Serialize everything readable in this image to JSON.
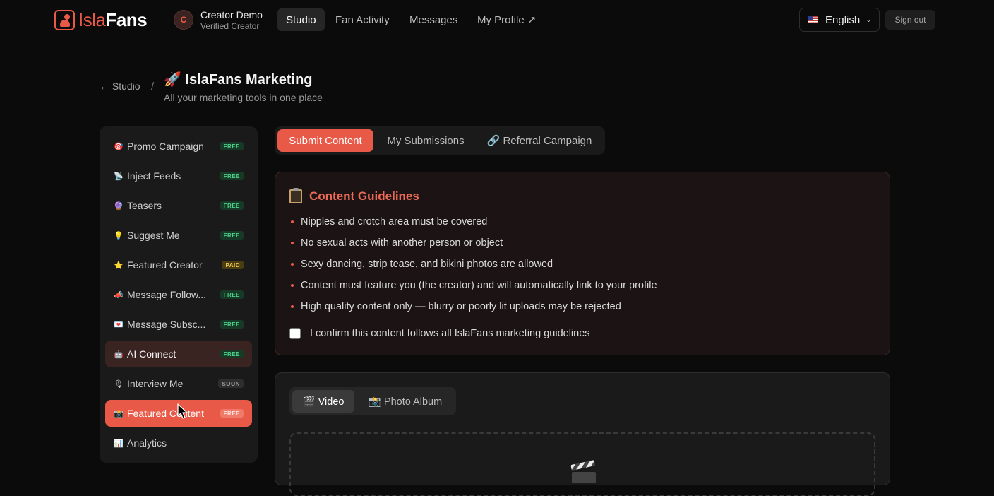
{
  "header": {
    "logo_isla": "Isla",
    "logo_fans": "Fans",
    "avatar_initial": "C",
    "creator_name": "Creator Demo",
    "creator_status": "Verified Creator",
    "nav": [
      {
        "label": "Studio",
        "active": true
      },
      {
        "label": "Fan Activity",
        "active": false
      },
      {
        "label": "Messages",
        "active": false
      },
      {
        "label": "My Profile ↗",
        "active": false
      }
    ],
    "language": "English",
    "sign_out": "Sign out"
  },
  "page": {
    "back_label": "← Studio",
    "separator": "/",
    "title": "🚀 IslaFans Marketing",
    "subtitle": "All your marketing tools in one place"
  },
  "sidebar": {
    "items": [
      {
        "icon": "🎯",
        "label": "Promo Campaign",
        "badge": "FREE",
        "state": "normal"
      },
      {
        "icon": "📡",
        "label": "Inject Feeds",
        "badge": "FREE",
        "state": "normal"
      },
      {
        "icon": "🔮",
        "label": "Teasers",
        "badge": "FREE",
        "state": "normal"
      },
      {
        "icon": "💡",
        "label": "Suggest Me",
        "badge": "FREE",
        "state": "normal"
      },
      {
        "icon": "⭐",
        "label": "Featured Creator",
        "badge": "PAID",
        "state": "normal"
      },
      {
        "icon": "📣",
        "label": "Message Follow...",
        "badge": "FREE",
        "state": "normal"
      },
      {
        "icon": "💌",
        "label": "Message Subsc...",
        "badge": "FREE",
        "state": "normal"
      },
      {
        "icon": "🤖",
        "label": "AI Connect",
        "badge": "FREE",
        "state": "hover"
      },
      {
        "icon": "🎙",
        "label": "Interview Me",
        "badge": "SOON",
        "state": "normal"
      },
      {
        "icon": "📸",
        "label": "Featured Content",
        "badge": "FREE",
        "state": "active"
      },
      {
        "icon": "📊",
        "label": "Analytics",
        "badge": "",
        "state": "normal"
      }
    ]
  },
  "tabs": [
    {
      "label": "Submit Content",
      "active": true
    },
    {
      "label": "My Submissions",
      "active": false
    },
    {
      "label": "🔗 Referral Campaign",
      "active": false
    }
  ],
  "guidelines": {
    "title": "Content Guidelines",
    "rules": [
      "Nipples and crotch area must be covered",
      "No sexual acts with another person or object",
      "Sexy dancing, strip tease, and bikini photos are allowed",
      "Content must feature you (the creator) and will automatically link to your profile",
      "High quality content only — blurry or poorly lit uploads may be rejected"
    ],
    "confirm_label": "I confirm this content follows all IslaFans marketing guidelines",
    "confirm_checked": false
  },
  "upload": {
    "media_tabs": [
      {
        "label": "🎬 Video",
        "active": true
      },
      {
        "label": "📸 Photo Album",
        "active": false
      }
    ]
  },
  "colors": {
    "accent": "#e85a47",
    "free_badge": "#4fd08a",
    "paid_badge": "#f2c94c"
  }
}
